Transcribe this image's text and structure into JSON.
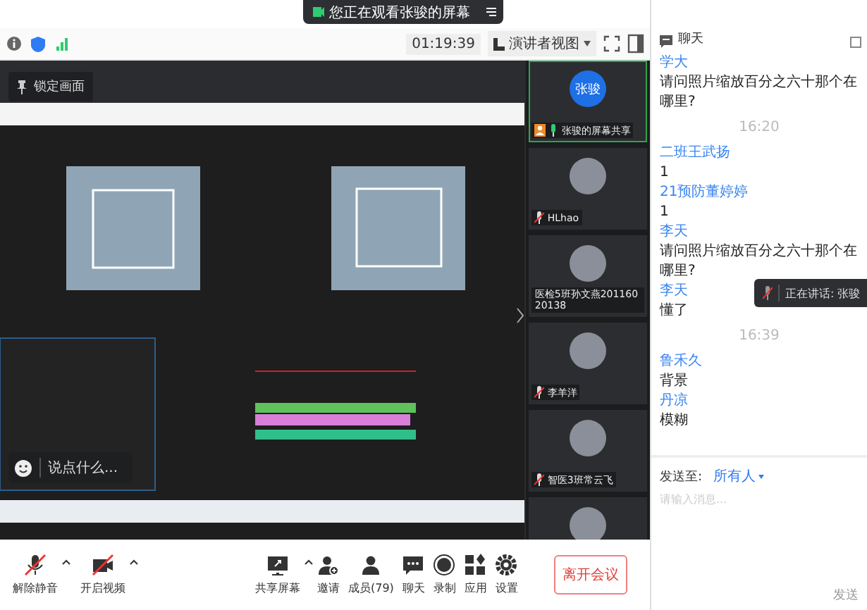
{
  "banner": {
    "text": "您正在观看张骏的屏幕"
  },
  "toolbar": {
    "timer": "01:19:39",
    "view_label": "演讲者视图"
  },
  "stage": {
    "lock_button": "锁定画面",
    "comment_prompt": "说点什么..."
  },
  "participants": [
    {
      "name": "张骏的屏幕共享",
      "avatar_text": "张骏",
      "muted": false,
      "speaking": true
    },
    {
      "name": "HLhao",
      "muted": true,
      "speaking": false
    },
    {
      "name": "医检5班孙文燕20116020138",
      "speaking": false
    },
    {
      "name": "李羊洋",
      "muted": true,
      "speaking": false
    },
    {
      "name": "智医3班常云飞",
      "muted": true,
      "speaking": false
    },
    {
      "speaking": false
    }
  ],
  "controls": [
    {
      "kind": "mic",
      "label": "解除静音",
      "caret": true,
      "off": true
    },
    {
      "kind": "video",
      "label": "开启视频",
      "caret": true,
      "off": true
    },
    {
      "kind": "share",
      "label": "共享屏幕",
      "caret": true,
      "off": false
    },
    {
      "kind": "invite",
      "label": "邀请",
      "caret": false,
      "off": false
    },
    {
      "kind": "members",
      "label": "成员(79)",
      "caret": false,
      "off": false
    },
    {
      "kind": "chat",
      "label": "聊天",
      "caret": false,
      "off": false
    },
    {
      "kind": "record",
      "label": "录制",
      "caret": false,
      "off": false
    },
    {
      "kind": "apps",
      "label": "应用",
      "caret": false,
      "off": false
    },
    {
      "kind": "settings",
      "label": "设置",
      "caret": false,
      "off": false
    }
  ],
  "leave_button": "离开会议",
  "chat": {
    "title": "聊天",
    "items": [
      {
        "kind": "sender",
        "text": "学大"
      },
      {
        "kind": "text",
        "text": "请问照片缩放百分之六十那个在哪里?"
      },
      {
        "kind": "time",
        "text": "16:20"
      },
      {
        "kind": "sender",
        "text": "二班王武扬"
      },
      {
        "kind": "text",
        "text": "1"
      },
      {
        "kind": "sender",
        "text": "21预防董婷婷"
      },
      {
        "kind": "text",
        "text": "1"
      },
      {
        "kind": "sender",
        "text": "李天"
      },
      {
        "kind": "text",
        "text": "请问照片缩放百分之六十那个在哪里?"
      },
      {
        "kind": "sender",
        "text": "李天"
      },
      {
        "kind": "text",
        "text": "懂了"
      },
      {
        "kind": "time",
        "text": "16:39"
      },
      {
        "kind": "sender",
        "text": "鲁禾久"
      },
      {
        "kind": "text",
        "text": "背景"
      },
      {
        "kind": "sender",
        "text": "丹凉"
      },
      {
        "kind": "text",
        "text": "模糊"
      }
    ],
    "toast": "正在讲话: 张骏",
    "send_to_label": "发送至:",
    "send_to_value": "所有人",
    "placeholder": "请输入消息...",
    "send_button": "发送"
  }
}
